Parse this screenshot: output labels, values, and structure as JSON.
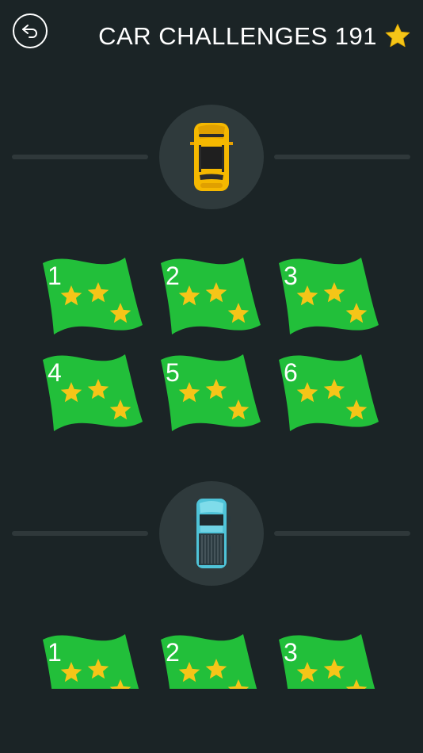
{
  "header": {
    "title": "CAR CHALLENGES 191",
    "back_icon": "back-arrow-icon",
    "star_icon": "star-icon"
  },
  "colors": {
    "background": "#1b2426",
    "flag_green": "#22bf3a",
    "star_yellow": "#f5c518",
    "taxi_yellow": "#f5b800",
    "truck_cyan": "#4fc3d8"
  },
  "sections": [
    {
      "vehicle": "taxi-car-icon",
      "levels": [
        {
          "label": "1",
          "stars": 3
        },
        {
          "label": "2",
          "stars": 3
        },
        {
          "label": "3",
          "stars": 3
        },
        {
          "label": "4",
          "stars": 3
        },
        {
          "label": "5",
          "stars": 3
        },
        {
          "label": "6",
          "stars": 3
        }
      ]
    },
    {
      "vehicle": "pickup-truck-icon",
      "levels": [
        {
          "label": "1",
          "stars": 3
        },
        {
          "label": "2",
          "stars": 3
        },
        {
          "label": "3",
          "stars": 3
        }
      ]
    }
  ]
}
